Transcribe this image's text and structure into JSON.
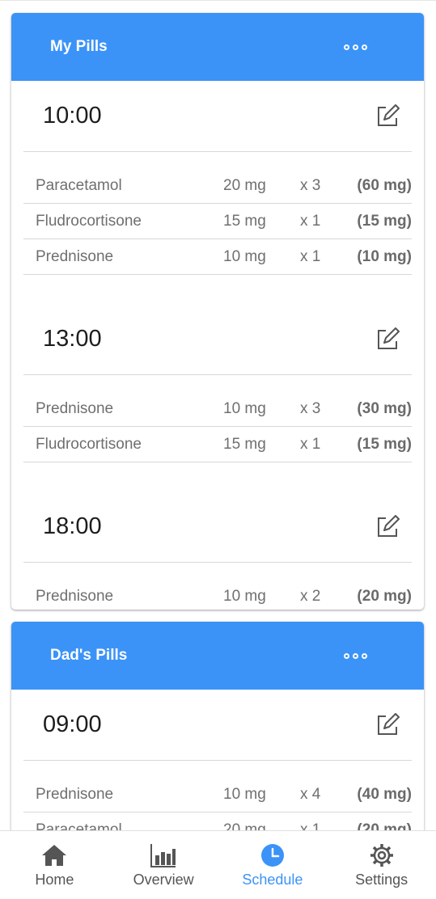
{
  "groups": [
    {
      "title": "My Pills",
      "more_icon": "more-horizontal-icon",
      "slots": [
        {
          "time": "10:00",
          "edit_icon": "edit-icon",
          "pills": [
            {
              "name": "Paracetamol",
              "dose": "20 mg",
              "count": "x 3",
              "total": "(60 mg)"
            },
            {
              "name": "Fludrocortisone",
              "dose": "15 mg",
              "count": "x 1",
              "total": "(15 mg)"
            },
            {
              "name": "Prednisone",
              "dose": "10 mg",
              "count": "x 1",
              "total": "(10 mg)"
            }
          ]
        },
        {
          "time": "13:00",
          "edit_icon": "edit-icon",
          "pills": [
            {
              "name": "Prednisone",
              "dose": "10 mg",
              "count": "x 3",
              "total": "(30 mg)"
            },
            {
              "name": "Fludrocortisone",
              "dose": "15 mg",
              "count": "x 1",
              "total": "(15 mg)"
            }
          ]
        },
        {
          "time": "18:00",
          "edit_icon": "edit-icon",
          "pills": [
            {
              "name": "Prednisone",
              "dose": "10 mg",
              "count": "x 2",
              "total": "(20 mg)"
            }
          ]
        }
      ]
    },
    {
      "title": "Dad's Pills",
      "more_icon": "more-horizontal-icon",
      "slots": [
        {
          "time": "09:00",
          "edit_icon": "edit-icon",
          "pills": [
            {
              "name": "Prednisone",
              "dose": "10 mg",
              "count": "x 4",
              "total": "(40 mg)"
            },
            {
              "name": "Paracetamol",
              "dose": "20 mg",
              "count": "x 1",
              "total": "(20 mg)"
            }
          ]
        }
      ]
    }
  ],
  "nav": {
    "items": [
      {
        "label": "Home",
        "icon": "home-icon"
      },
      {
        "label": "Overview",
        "icon": "bar-chart-icon"
      },
      {
        "label": "Schedule",
        "icon": "clock-icon"
      },
      {
        "label": "Settings",
        "icon": "gear-icon"
      }
    ],
    "active_index": 2
  },
  "colors": {
    "accent": "#3b93f7",
    "text_primary": "#1d1d1d",
    "text_secondary": "#6f6f6f",
    "divider": "#d8d8d8"
  }
}
